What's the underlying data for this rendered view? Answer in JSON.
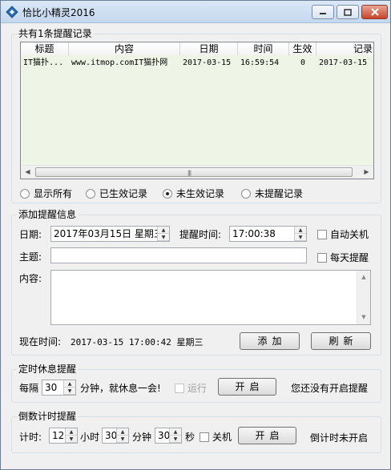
{
  "window": {
    "title": "恰比小精灵2016",
    "minimize": "—",
    "maximize": "□",
    "close": "✕"
  },
  "records": {
    "group_label": "共有1条提醒记录",
    "columns": [
      "标题",
      "内容",
      "日期",
      "时间",
      "生效",
      "记录"
    ],
    "rows": [
      {
        "title": "IT猫扑...",
        "content": "www.itmop.comIT猫扑网",
        "date": "2017-03-15",
        "time": "16:59:54",
        "active": "0",
        "record": "2017-03-15"
      }
    ],
    "filters": [
      {
        "label": "显示所有",
        "checked": false
      },
      {
        "label": "已生效记录",
        "checked": false
      },
      {
        "label": "未生效记录",
        "checked": true
      },
      {
        "label": "未提醒记录",
        "checked": false
      }
    ]
  },
  "add_reminder": {
    "group_label": "添加提醒信息",
    "date_label": "日期:",
    "date_value": "2017年03月15日  星期三",
    "time_label": "提醒时间:",
    "time_value": "17:00:38",
    "auto_shutdown_label": "自动关机",
    "subject_label": "主题:",
    "subject_value": "",
    "daily_label": "每天提醒",
    "content_label": "内容:",
    "content_value": "",
    "now_label": "现在时间:",
    "now_value": "2017-03-15 17:00:42 星期三",
    "add_button": "添加",
    "refresh_button": "刷新"
  },
  "rest_reminder": {
    "group_label": "定时休息提醒",
    "every_label": "每隔",
    "minutes_value": "30",
    "suffix_label": "分钟，就休息一会!",
    "run_label": "运行",
    "start_button": "开启",
    "status": "您还没有开启提醒"
  },
  "countdown": {
    "group_label": "倒数计时提醒",
    "timer_label": "计时:",
    "hours_value": "12",
    "hours_label": "小时",
    "minutes_value": "30",
    "minutes_label": "分钟",
    "seconds_value": "30",
    "seconds_label": "秒",
    "shutdown_label": "关机",
    "start_button": "开启",
    "status": "倒计时未开启"
  }
}
